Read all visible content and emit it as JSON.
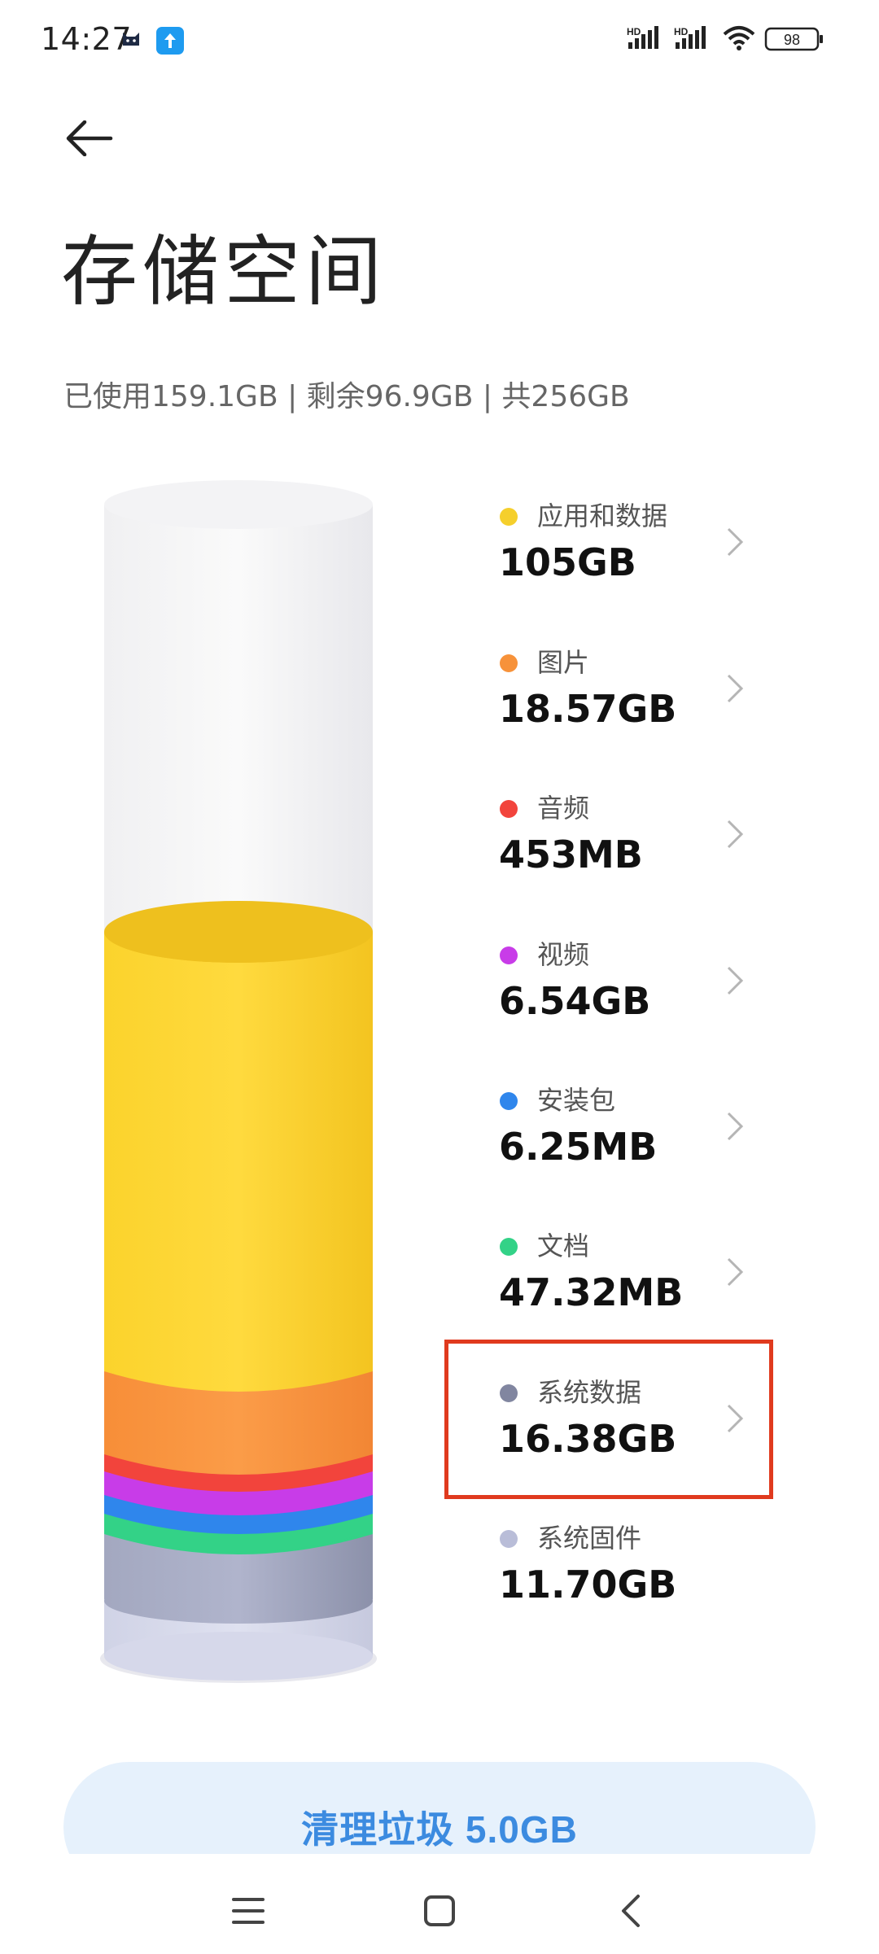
{
  "status_bar": {
    "time": "14:27",
    "battery": "98",
    "icons": [
      "cat-app-icon",
      "upload-app-icon",
      "hd-signal-icon",
      "hd-signal-icon",
      "wifi-icon",
      "battery-icon"
    ]
  },
  "header": {
    "back_icon": "back-arrow-icon",
    "title": "存储空间"
  },
  "summary": {
    "text": "已使用159.1GB | 剩余96.9GB | 共256GB",
    "used_gb": 159.1,
    "free_gb": 96.9,
    "total_gb": 256
  },
  "categories": [
    {
      "name": "应用和数据",
      "size": "105GB",
      "color": "#f5cf2c"
    },
    {
      "name": "图片",
      "size": "18.57GB",
      "color": "#f7923a"
    },
    {
      "name": "音频",
      "size": "453MB",
      "color": "#f2443c"
    },
    {
      "name": "视频",
      "size": "6.54GB",
      "color": "#c83ce8"
    },
    {
      "name": "安装包",
      "size": "6.25MB",
      "color": "#2f86ec"
    },
    {
      "name": "文档",
      "size": "47.32MB",
      "color": "#33d287"
    },
    {
      "name": "系统数据",
      "size": "16.38GB",
      "color": "#8186a0"
    },
    {
      "name": "系统固件",
      "size": "11.70GB",
      "color": "#b9bdd8"
    }
  ],
  "clean_button": {
    "label": "清理垃圾 5.0GB"
  },
  "nav_bar": {
    "icons": [
      "menu-icon",
      "home-icon",
      "back-icon"
    ]
  }
}
